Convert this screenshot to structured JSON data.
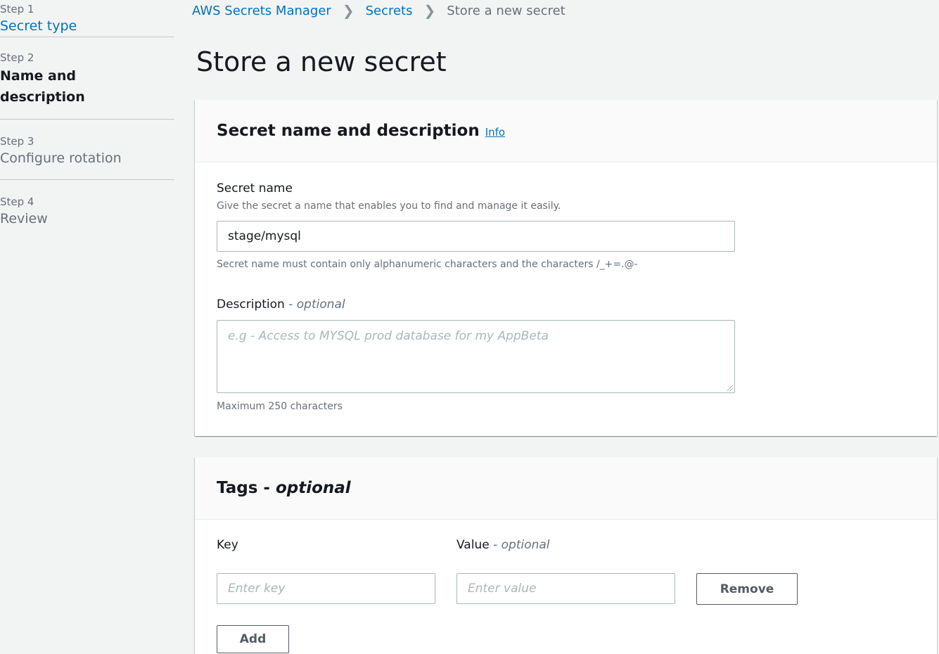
{
  "sidebar": {
    "steps": [
      {
        "num": "Step 1",
        "title": "Secret type"
      },
      {
        "num": "Step 2",
        "title": "Name and description"
      },
      {
        "num": "Step 3",
        "title": "Configure rotation"
      },
      {
        "num": "Step 4",
        "title": "Review"
      }
    ]
  },
  "breadcrumb": {
    "root": "AWS Secrets Manager",
    "secrets": "Secrets",
    "current": "Store a new secret"
  },
  "page": {
    "title": "Store a new secret"
  },
  "name_panel": {
    "heading": "Secret name and description",
    "info": "Info",
    "secret_name_label": "Secret name",
    "secret_name_desc": "Give the secret a name that enables you to find and manage it easily.",
    "secret_name_value": "stage/mysql",
    "secret_name_constraint": "Secret name must contain only alphanumeric characters and the characters /_+=.@-",
    "description_label": "Description",
    "description_optional": "- optional",
    "description_placeholder": "e.g - Access to MYSQL prod database for my AppBeta",
    "description_constraint": "Maximum 250 characters"
  },
  "tags_panel": {
    "heading": "Tags -",
    "heading_optional": "optional",
    "key_label": "Key",
    "value_label": "Value",
    "value_optional": "- optional",
    "key_placeholder": "Enter key",
    "value_placeholder": "Enter value",
    "remove_label": "Remove",
    "add_label": "Add"
  },
  "colors": {
    "link": "#0073bb",
    "background": "#f2f3f3",
    "muted": "#687078"
  }
}
